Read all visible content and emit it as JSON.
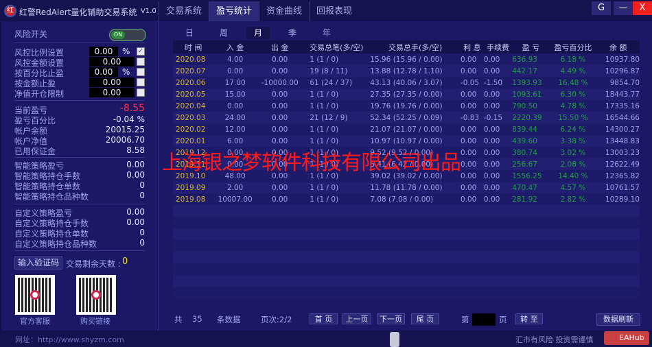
{
  "app": {
    "title": "红警RedAlert量化辅助交易系统",
    "version": "V1.0",
    "logo_text": "红"
  },
  "tabs": [
    "交易系统",
    "盈亏统计",
    "资金曲线",
    "回报表现"
  ],
  "window": {
    "refresh_icon": "G",
    "minimize": "—",
    "close": "X"
  },
  "left": {
    "risk_switch": "风险开关",
    "toggle": "ON",
    "settings": [
      {
        "label": "风控比例设置",
        "value": "0.00",
        "unit": "%",
        "checked": true
      },
      {
        "label": "风控金额设置",
        "value": "0.00",
        "unit": "",
        "checked": false
      },
      {
        "label": "按百分比止盈",
        "value": "0.00",
        "unit": "%",
        "checked": false
      },
      {
        "label": "按金额止盈",
        "value": "0.00",
        "unit": "",
        "checked": false
      },
      {
        "label": "净值开仓限制",
        "value": "0.00",
        "unit": "",
        "checked": false
      }
    ],
    "account": [
      {
        "label": "当前盈亏",
        "value": "-8.55"
      },
      {
        "label": "盈亏百分比",
        "value": "-0.04 %"
      },
      {
        "label": "帐户余额",
        "value": "20015.25"
      },
      {
        "label": "帐户净值",
        "value": "20006.70"
      },
      {
        "label": "已用保证金",
        "value": "8.58"
      }
    ],
    "smart": [
      {
        "label": "智能策略盈亏",
        "value": "0.00"
      },
      {
        "label": "智能策略持仓手数",
        "value": "0.00"
      },
      {
        "label": "智能策略持仓单数",
        "value": "0"
      },
      {
        "label": "智能策略持仓品种数",
        "value": "0"
      }
    ],
    "custom": [
      {
        "label": "自定义策略盈亏",
        "value": "0.00"
      },
      {
        "label": "自定义策略持仓手数",
        "value": "0.00"
      },
      {
        "label": "自定义策略持仓单数",
        "value": "0"
      },
      {
        "label": "自定义策略持仓品种数",
        "value": "0"
      }
    ],
    "verify_button": "输入验证码",
    "days_label": "交易剩余天数 :",
    "days_value": "0",
    "qr1_label": "官方客服",
    "qr2_label": "购买链接"
  },
  "periods": [
    "日",
    "周",
    "月",
    "季",
    "年"
  ],
  "table": {
    "headers": [
      "时 间",
      "入 金",
      "出 金",
      "交易总笔(多/空)",
      "交易总手(多/空)",
      "利 息",
      "手续费",
      "盈 亏",
      "盈亏百分比",
      "余 额"
    ],
    "rows": [
      [
        "2020.08",
        "4.00",
        "0.00",
        "1  (1 / 0)",
        "15.96  (15.96 / 0.00)",
        "0.00",
        "0.00",
        "636.93",
        "6.18 %",
        "10937.80"
      ],
      [
        "2020.07",
        "0.00",
        "0.00",
        "19  (8 / 11)",
        "13.88  (12.78 / 1.10)",
        "0.00",
        "0.00",
        "442.17",
        "4.49 %",
        "10296.87"
      ],
      [
        "2020.06",
        "17.00",
        "-10000.00",
        "61  (24 / 37)",
        "43.13  (40.06 / 3.07)",
        "-0.05",
        "-1.50",
        "1393.93",
        "16.48 %",
        "9854.70"
      ],
      [
        "2020.05",
        "15.00",
        "0.00",
        "1  (1 / 0)",
        "27.35  (27.35 / 0.00)",
        "0.00",
        "0.00",
        "1093.61",
        "6.30 %",
        "18443.77"
      ],
      [
        "2020.04",
        "0.00",
        "0.00",
        "1  (1 / 0)",
        "19.76  (19.76 / 0.00)",
        "0.00",
        "0.00",
        "790.50",
        "4.78 %",
        "17335.16"
      ],
      [
        "2020.03",
        "24.00",
        "0.00",
        "21  (12 / 9)",
        "52.34  (52.25 / 0.09)",
        "-0.83",
        "-0.15",
        "2220.39",
        "15.50 %",
        "16544.66"
      ],
      [
        "2020.02",
        "12.00",
        "0.00",
        "1  (1 / 0)",
        "21.07  (21.07 / 0.00)",
        "0.00",
        "0.00",
        "839.44",
        "6.24 %",
        "14300.27"
      ],
      [
        "2020.01",
        "6.00",
        "0.00",
        "1  (1 / 0)",
        "10.97  (10.97 / 0.00)",
        "0.00",
        "0.00",
        "439.60",
        "3.38 %",
        "13448.83"
      ],
      [
        "2019.12",
        "0.00",
        "0.00",
        "1  (1 / 0)",
        "9.52  (9.52 / 0.00)",
        "0.00",
        "0.00",
        "380.74",
        "3.02 %",
        "13003.23"
      ],
      [
        "2019.11",
        "0.00",
        "0.00",
        "1  (1 / 0)",
        "6.41  (6.42 / 0.00)",
        "0.00",
        "0.00",
        "256.67",
        "2.08 %",
        "12622.49"
      ],
      [
        "2019.10",
        "48.00",
        "0.00",
        "1  (1 / 0)",
        "39.02  (39.02 / 0.00)",
        "0.00",
        "0.00",
        "1556.25",
        "14.40 %",
        "12365.82"
      ],
      [
        "2019.09",
        "2.00",
        "0.00",
        "1  (1 / 0)",
        "11.78  (11.78 / 0.00)",
        "0.00",
        "0.00",
        "470.47",
        "4.57 %",
        "10761.57"
      ],
      [
        "2019.08",
        "10007.00",
        "0.00",
        "1  (1 / 0)",
        "7.08  (7.08 / 0.00)",
        "0.00",
        "0.00",
        "281.92",
        "2.82 %",
        "10289.10"
      ]
    ],
    "empty_rows": 8
  },
  "pager": {
    "total_prefix": "共",
    "total": "35",
    "total_suffix": "条数据",
    "page_label": "页次:2/2",
    "first": "首 页",
    "prev": "上一页",
    "next": "下一页",
    "last": "尾 页",
    "goto_prefix": "第",
    "goto_suffix": "页",
    "goto": "转 至",
    "refresh": "数据刷新"
  },
  "footer": {
    "website": "网址：http://www.shyzm.com",
    "risk": "汇市有风险  投资需谨慎",
    "badge": "EAHub"
  },
  "watermark": "上海银之梦软件科技有限公司出品"
}
